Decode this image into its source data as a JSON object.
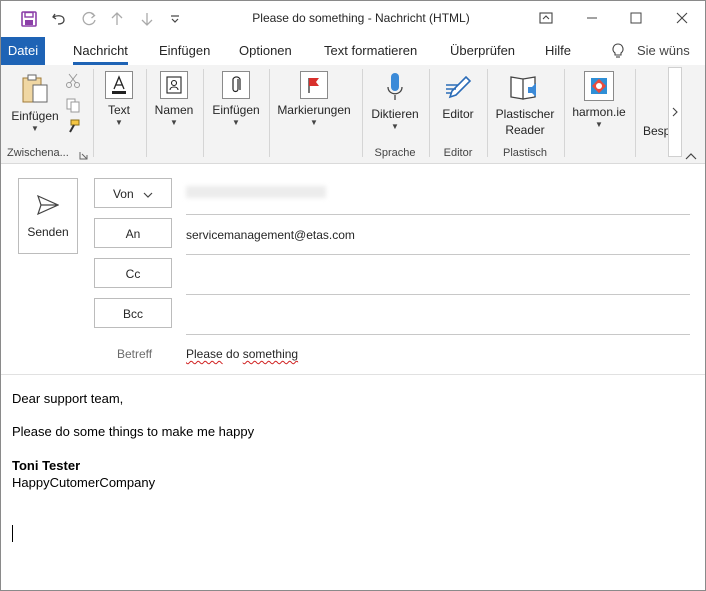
{
  "window": {
    "title": "Please do something  -  Nachricht (HTML)"
  },
  "tabs": [
    {
      "label": "Datei"
    },
    {
      "label": "Nachricht"
    },
    {
      "label": "Einfügen"
    },
    {
      "label": "Optionen"
    },
    {
      "label": "Text formatieren"
    },
    {
      "label": "Überprüfen"
    },
    {
      "label": "Hilfe"
    }
  ],
  "tell_me": {
    "label": "Sie wüns"
  },
  "ribbon": {
    "clipboard": {
      "paste_label": "Einfügen",
      "group_label": "Zwischena..."
    },
    "text": {
      "label": "Text"
    },
    "names": {
      "label": "Namen"
    },
    "insert": {
      "label": "Einfügen"
    },
    "tags": {
      "label": "Markierungen"
    },
    "dictate": {
      "label": "Diktieren",
      "group_label": "Sprache"
    },
    "editor": {
      "label": "Editor",
      "group_label": "Editor"
    },
    "reader": {
      "label1": "Plastischer",
      "label2": "Reader",
      "group_label": "Plastisch"
    },
    "harmon": {
      "label": "harmon.ie"
    },
    "besp": {
      "label": "Besp"
    }
  },
  "compose": {
    "send_label": "Senden",
    "from_label": "Von",
    "to_label": "An",
    "to_value": "servicemanagement@etas.com",
    "cc_label": "Cc",
    "bcc_label": "Bcc",
    "subject_label": "Betreff",
    "subject_word1": "Please",
    "subject_mid": " do ",
    "subject_word2": "something"
  },
  "body": {
    "greeting": "Dear support team,",
    "line1": "Please do some things to make me happy",
    "sig_name": "Toni Tester",
    "sig_company": "HappyCutomerCompany"
  },
  "colors": {
    "accent": "#1e63b5",
    "save_icon": "#8b3fa8",
    "spell_error": "#d02020"
  }
}
